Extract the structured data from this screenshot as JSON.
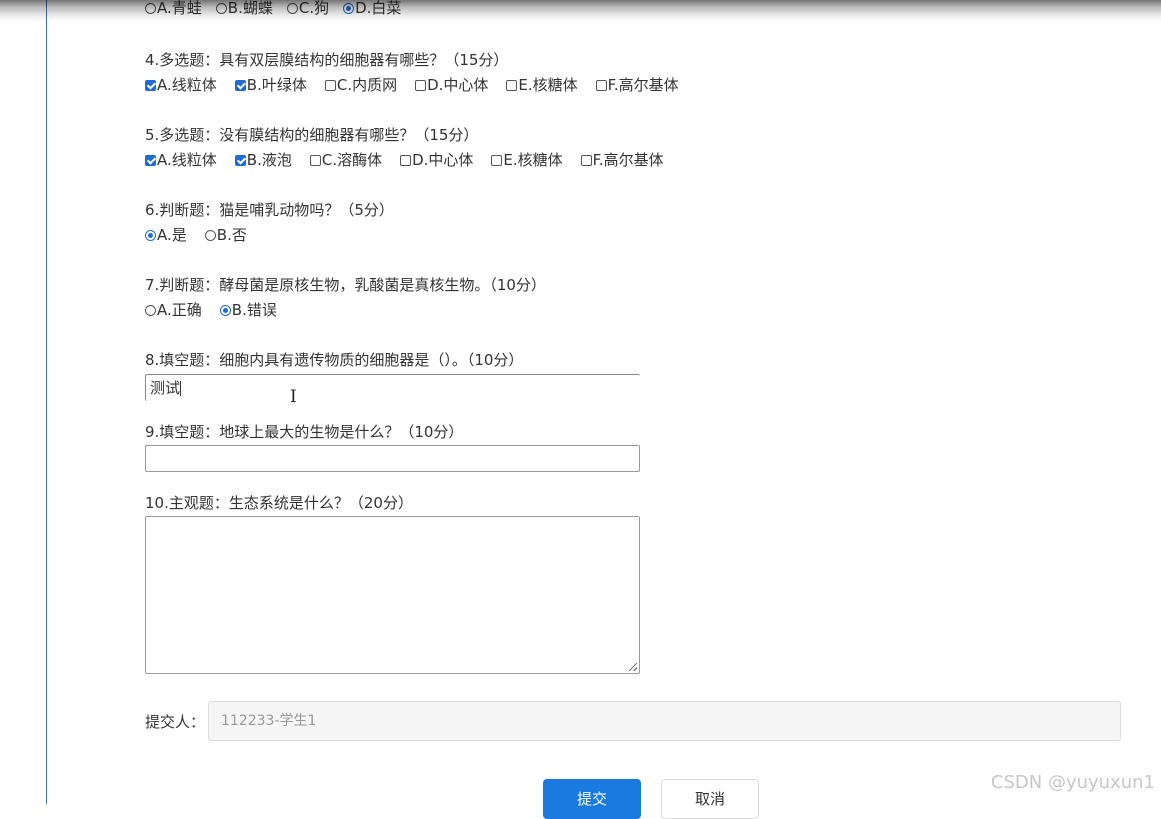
{
  "q3": {
    "options": [
      {
        "label": "A.青蛙",
        "selected": false
      },
      {
        "label": "B.蝴蝶",
        "selected": false
      },
      {
        "label": "C.狗",
        "selected": false
      },
      {
        "label": "D.白菜",
        "selected": true
      }
    ]
  },
  "q4": {
    "title": "4.多选题：具有双层膜结构的细胞器有哪些？（15分）",
    "options": [
      {
        "label": "A.线粒体",
        "checked": true
      },
      {
        "label": "B.叶绿体",
        "checked": true
      },
      {
        "label": "C.内质网",
        "checked": false
      },
      {
        "label": "D.中心体",
        "checked": false
      },
      {
        "label": "E.核糖体",
        "checked": false
      },
      {
        "label": "F.高尔基体",
        "checked": false
      }
    ]
  },
  "q5": {
    "title": "5.多选题：没有膜结构的细胞器有哪些？（15分）",
    "options": [
      {
        "label": "A.线粒体",
        "checked": true
      },
      {
        "label": "B.液泡",
        "checked": true
      },
      {
        "label": "C.溶酶体",
        "checked": false
      },
      {
        "label": "D.中心体",
        "checked": false
      },
      {
        "label": "E.核糖体",
        "checked": false
      },
      {
        "label": "F.高尔基体",
        "checked": false
      }
    ]
  },
  "q6": {
    "title": "6.判断题：猫是哺乳动物吗？（5分）",
    "options": [
      {
        "label": "A.是",
        "selected": true
      },
      {
        "label": "B.否",
        "selected": false
      }
    ]
  },
  "q7": {
    "title": "7.判断题：酵母菌是原核生物，乳酸菌是真核生物。（10分）",
    "options": [
      {
        "label": "A.正确",
        "selected": false
      },
      {
        "label": "B.错误",
        "selected": true
      }
    ]
  },
  "q8": {
    "title": "8.填空题：细胞内具有遗传物质的细胞器是（）。（10分）",
    "value": "测试"
  },
  "q9": {
    "title": "9.填空题：地球上最大的生物是什么？（10分）",
    "value": ""
  },
  "q10": {
    "title": "10.主观题：生态系统是什么？（20分）",
    "value": ""
  },
  "submitter": {
    "label": "提交人：",
    "value": "112233-学生1"
  },
  "buttons": {
    "submit": "提交",
    "cancel": "取消"
  },
  "watermark": "CSDN @yuyuxun1",
  "colors": {
    "accent": "#1a7ae0",
    "left_rule": "#3b73b9"
  }
}
